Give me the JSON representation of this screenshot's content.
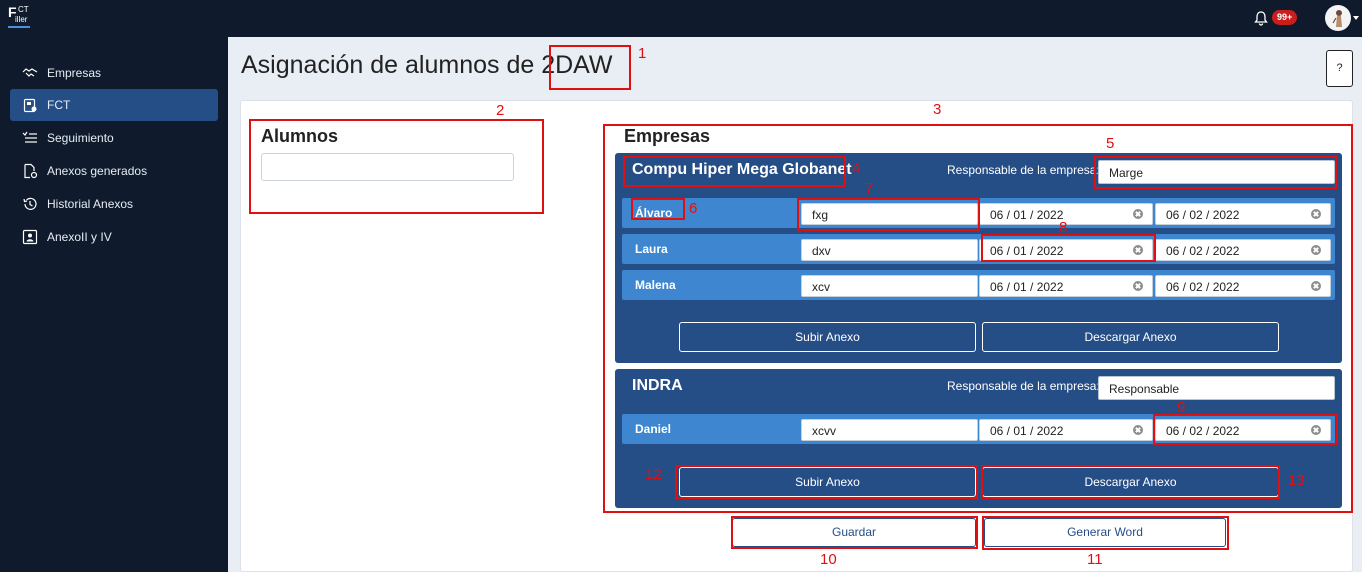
{
  "topbar": {
    "logo": {
      "l1": "F",
      "l2": "CT",
      "l3": "iller"
    },
    "notifications_badge": "99+",
    "bell_icon": "bell-icon",
    "avatar_icon": "user-avatar"
  },
  "sidebar": {
    "items": [
      {
        "label": "Empresas",
        "icon": "handshake-icon"
      },
      {
        "label": "FCT",
        "icon": "clipboard-icon"
      },
      {
        "label": "Seguimiento",
        "icon": "checklist-icon"
      },
      {
        "label": "Anexos generados",
        "icon": "file-gear-icon"
      },
      {
        "label": "Historial Anexos",
        "icon": "history-icon"
      },
      {
        "label": "AnexoII y IV",
        "icon": "id-card-icon"
      }
    ],
    "active_index": 1
  },
  "header": {
    "title": "Asignación de alumnos de 2DAW",
    "help_label": "?"
  },
  "alumnos": {
    "title": "Alumnos"
  },
  "empresas": {
    "title": "Empresas",
    "companies": [
      {
        "name": "Compu Hiper Mega Globanet",
        "resp_label": "Responsable de la empresa:",
        "resp_value": "Marge",
        "students": [
          {
            "name": "Álvaro",
            "tutor": "fxg",
            "start": "06 / 01 / 2022",
            "end": "06 / 02 / 2022"
          },
          {
            "name": "Laura",
            "tutor": "dxv",
            "start": "06 / 01 / 2022",
            "end": "06 / 02 / 2022"
          },
          {
            "name": "Malena",
            "tutor": "xcv",
            "start": "06 / 01 / 2022",
            "end": "06 / 02 / 2022"
          }
        ],
        "upload_label": "Subir Anexo",
        "download_label": "Descargar Anexo"
      },
      {
        "name": "INDRA",
        "resp_label": "Responsable de la empresa:",
        "resp_value": "Responsable",
        "students": [
          {
            "name": "Daniel",
            "tutor": "xcvv",
            "start": "06 / 01 / 2022",
            "end": "06 / 02 / 2022"
          }
        ],
        "upload_label": "Subir Anexo",
        "download_label": "Descargar Anexo"
      }
    ]
  },
  "footer": {
    "save_label": "Guardar",
    "word_label": "Generar Word"
  },
  "annotations": [
    "1",
    "2",
    "3",
    "4",
    "5",
    "6",
    "7",
    "8",
    "9",
    "10",
    "11",
    "12",
    "13"
  ],
  "annotation_color": "#e01010"
}
